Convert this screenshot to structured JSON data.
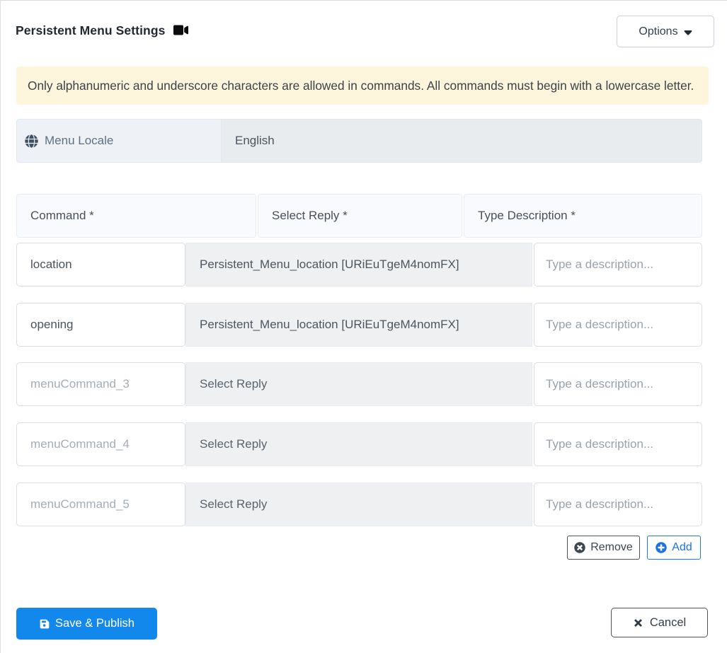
{
  "header": {
    "title": "Persistent Menu Settings",
    "options_label": "Options"
  },
  "alert": {
    "text": "Only alphanumeric and underscore characters are allowed in commands. All commands must begin with a lowercase letter."
  },
  "locale": {
    "label": "Menu Locale",
    "value": "English"
  },
  "table": {
    "headers": {
      "command": "Command *",
      "reply": "Select Reply *",
      "description": "Type Description *"
    },
    "rows": [
      {
        "command": "location",
        "command_placeholder": "",
        "reply": "Persistent_Menu_location [URiEuTgeM4nomFX]",
        "description_value": "",
        "description_placeholder": "Type a description..."
      },
      {
        "command": "opening",
        "command_placeholder": "",
        "reply": "Persistent_Menu_location [URiEuTgeM4nomFX]",
        "description_value": "",
        "description_placeholder": "Type a description..."
      },
      {
        "command": "",
        "command_placeholder": "menuCommand_3",
        "reply": "Select Reply",
        "description_value": "",
        "description_placeholder": "Type a description..."
      },
      {
        "command": "",
        "command_placeholder": "menuCommand_4",
        "reply": "Select Reply",
        "description_value": "",
        "description_placeholder": "Type a description..."
      },
      {
        "command": "",
        "command_placeholder": "menuCommand_5",
        "reply": "Select Reply",
        "description_value": "",
        "description_placeholder": "Type a description..."
      }
    ],
    "remove_label": "Remove",
    "add_label": "Add"
  },
  "footer": {
    "save_label": "Save & Publish",
    "cancel_label": "Cancel"
  },
  "colors": {
    "primary_blue": "#1287ec",
    "link_blue": "#1b73e8",
    "alert_bg": "#fdf6dd",
    "dark_slate": "#3e464e"
  }
}
